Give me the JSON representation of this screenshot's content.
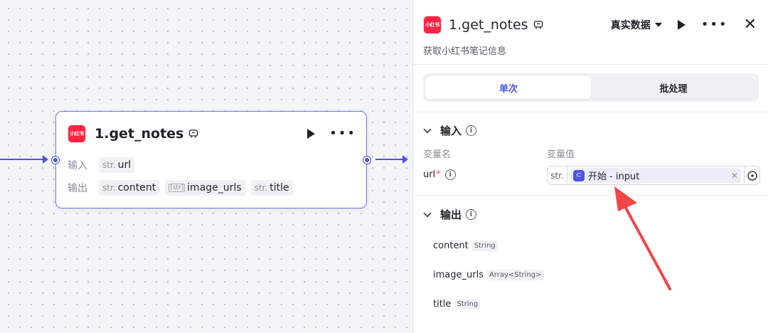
{
  "node": {
    "title": "1.get_notes",
    "logo_text": "小红书",
    "input_label": "输入",
    "output_label": "输出",
    "inputs": [
      {
        "type": "str.",
        "name": "url"
      }
    ],
    "outputs": [
      {
        "type": "str.",
        "name": "content"
      },
      {
        "type": "[str]",
        "name": "image_urls"
      },
      {
        "type": "str.",
        "name": "title"
      }
    ]
  },
  "panel": {
    "title": "1.get_notes",
    "description": "获取小红书笔记信息",
    "data_mode": "真实数据",
    "tabs": [
      {
        "label": "单次",
        "active": true
      },
      {
        "label": "批处理",
        "active": false
      }
    ],
    "input_section": {
      "title": "输入",
      "col_name": "变量名",
      "col_value": "变量值",
      "param_name": "url",
      "param_required": "*",
      "param_type": "str.",
      "param_ref": "开始 - input"
    },
    "output_section": {
      "title": "输出",
      "fields": [
        {
          "name": "content",
          "type": "String"
        },
        {
          "name": "image_urls",
          "type": "Array<String>"
        },
        {
          "name": "title",
          "type": "String"
        }
      ]
    }
  },
  "colors": {
    "accent": "#4d53e8",
    "annotation_arrow": "#f04646",
    "logo_red": "#ff2442"
  }
}
